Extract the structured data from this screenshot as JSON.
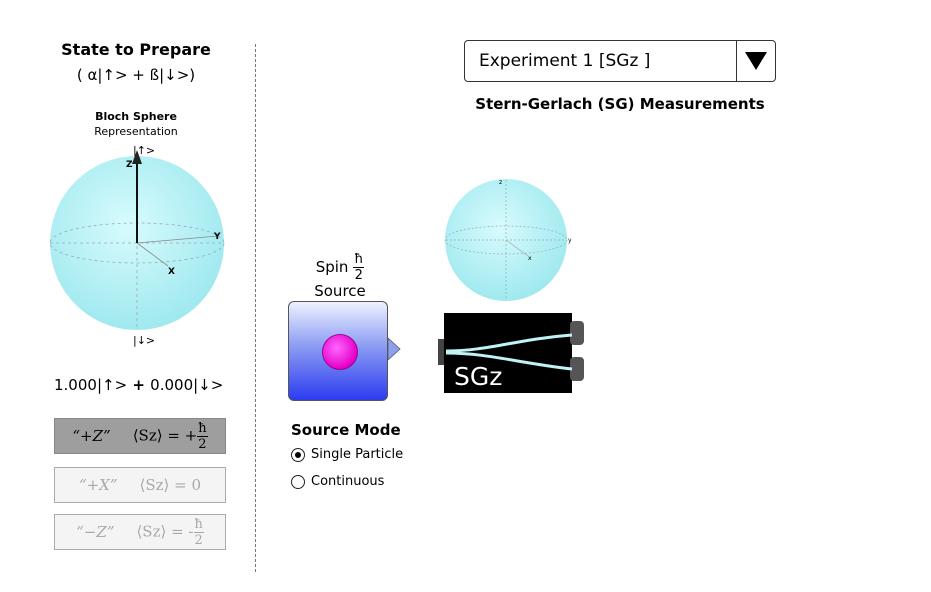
{
  "left_panel": {
    "title": "State to Prepare",
    "formula": "( α|↑> + ß|↓>)",
    "bloch_title": "Bloch Sphere",
    "bloch_subtitle": "Representation",
    "sphere": {
      "up_label": "|↑>",
      "down_label": "|↓>",
      "axis_z": "Z",
      "axis_y": "Y",
      "axis_x": "X",
      "color": "#b8f1f5"
    },
    "state_readout": {
      "alpha": "1.000",
      "up": "|↑>",
      "plus": " + ",
      "beta": "0.000",
      "down": "|↓>"
    },
    "presets": [
      {
        "name": "“+Z”",
        "expect": "⟨Sz⟩ = +",
        "num": "ħ",
        "den": "2",
        "state": "selected"
      },
      {
        "name": "“+X”",
        "expect": "⟨Sz⟩ = 0",
        "state": "disabled"
      },
      {
        "name": "“−Z”",
        "expect": "⟨Sz⟩ = -",
        "num": "ħ",
        "den": "2",
        "state": "disabled"
      }
    ]
  },
  "experiment": {
    "selected": "Experiment 1   [SGz ]",
    "section_title": "Stern-Gerlach (SG) Measurements"
  },
  "source": {
    "label_line1": "Spin",
    "frac_num": "ħ",
    "frac_den": "2",
    "label_line2": "Source",
    "mode_title": "Source Mode",
    "modes": [
      {
        "label": "Single Particle",
        "selected": true
      },
      {
        "label": "Continuous",
        "selected": false
      }
    ],
    "particle_color": "#ff33e0"
  },
  "sg": {
    "magnet_label": "SGz",
    "sphere_axes": {
      "z": "z",
      "y": "y",
      "x": "x"
    }
  }
}
